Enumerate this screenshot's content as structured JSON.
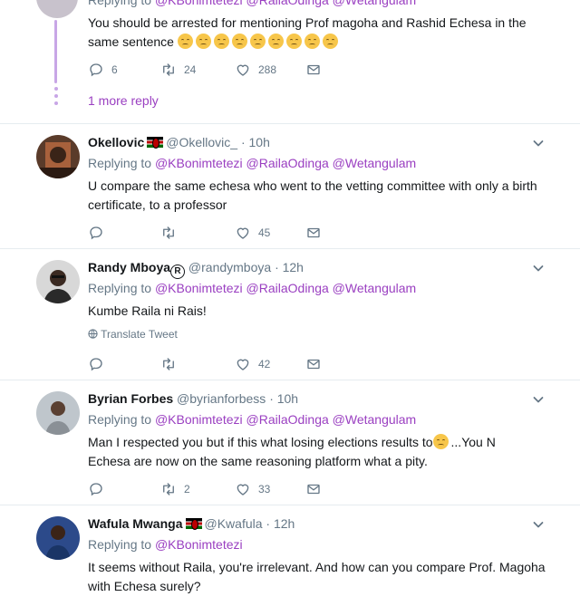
{
  "top_tweet": {
    "replying_prefix": "Replying to ",
    "replying_to": "@KBonimtetezi @RailaOdinga @Wetangulam",
    "text": "You should be arrested for mentioning Prof magoha and Rashid Echesa in the same sentence",
    "emoji_count": 9,
    "replies": "6",
    "retweets": "24",
    "likes": "288",
    "more_replies": "1 more reply"
  },
  "tweets": [
    {
      "name": "Okellovic",
      "handle": "@Okellovic_",
      "time": "· 10h",
      "replying_prefix": "Replying to ",
      "replying_to": "@KBonimtetezi @RailaOdinga @Wetangulam",
      "text": "U compare the same echesa who went to the vetting committee with only a birth certificate, to a professor",
      "replies": "",
      "retweets": "",
      "likes": "45"
    },
    {
      "name": "Randy Mboya",
      "handle": "@randymboya",
      "time": "· 12h",
      "replying_prefix": "Replying to ",
      "replying_to": "@KBonimtetezi @RailaOdinga @Wetangulam",
      "text": "Kumbe Raila ni Rais!",
      "translate": "Translate Tweet",
      "replies": "",
      "retweets": "",
      "likes": "42"
    },
    {
      "name": "Byrian Forbes",
      "handle": "@byrianforbess",
      "time": "· 10h",
      "replying_prefix": "Replying to ",
      "replying_to": "@KBonimtetezi @RailaOdinga @Wetangulam",
      "text_a": "Man I respected you but if this what losing elections results to",
      "text_b": "...You N Echesa are now on the same reasoning platform what a pity.",
      "replies": "",
      "retweets": "2",
      "likes": "33"
    },
    {
      "name": "Wafula Mwanga",
      "handle": "@Kwafula",
      "time": "· 12h",
      "replying_prefix": "Replying to ",
      "replying_to": "@KBonimtetezi",
      "text": "It seems without Raila, you're irrelevant. And how can you compare Prof. Magoha with Echesa surely?"
    }
  ],
  "colors": {
    "link": "#9a3fc1",
    "muted": "#657786",
    "divider": "#e6ecf0",
    "thread": "#c8a6e6"
  }
}
